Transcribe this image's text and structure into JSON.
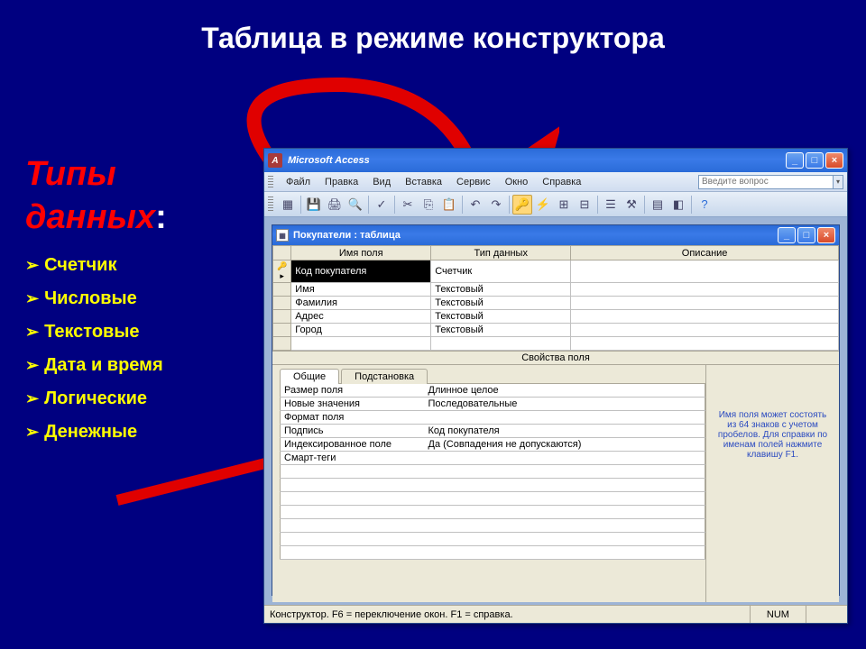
{
  "slide": {
    "title": "Таблица в режиме конструктора",
    "subtitle": "Типы данных",
    "colon": ":",
    "types": [
      "Счетчик",
      "Числовые",
      "Текстовые",
      "Дата и время",
      "Логические",
      "Денежные"
    ]
  },
  "app": {
    "title": "Microsoft Access",
    "menus": [
      "Файл",
      "Правка",
      "Вид",
      "Вставка",
      "Сервис",
      "Окно",
      "Справка"
    ],
    "question_placeholder": "Введите вопрос"
  },
  "child": {
    "title": "Покупатели : таблица"
  },
  "grid": {
    "headers": {
      "name": "Имя поля",
      "type": "Тип данных",
      "desc": "Описание"
    },
    "rows": [
      {
        "name": "Код покупателя",
        "type": "Счетчик",
        "key": true,
        "selected": true
      },
      {
        "name": "Имя",
        "type": "Текстовый"
      },
      {
        "name": "Фамилия",
        "type": "Текстовый"
      },
      {
        "name": "Адрес",
        "type": "Текстовый"
      },
      {
        "name": "Город",
        "type": "Текстовый"
      }
    ]
  },
  "props": {
    "header": "Свойства поля",
    "tabs": {
      "general": "Общие",
      "lookup": "Подстановка"
    },
    "rows": [
      {
        "label": "Размер поля",
        "value": "Длинное целое"
      },
      {
        "label": "Новые значения",
        "value": "Последовательные"
      },
      {
        "label": "Формат поля",
        "value": ""
      },
      {
        "label": "Подпись",
        "value": "Код покупателя"
      },
      {
        "label": "Индексированное поле",
        "value": "Да (Совпадения не допускаются)"
      },
      {
        "label": "Смарт-теги",
        "value": ""
      }
    ],
    "help": "Имя поля может состоять из 64 знаков с учетом пробелов. Для справки по именам полей нажмите клавишу F1."
  },
  "status": {
    "text": "Конструктор. F6 = переключение окон. F1 = справка.",
    "num": "NUM"
  }
}
